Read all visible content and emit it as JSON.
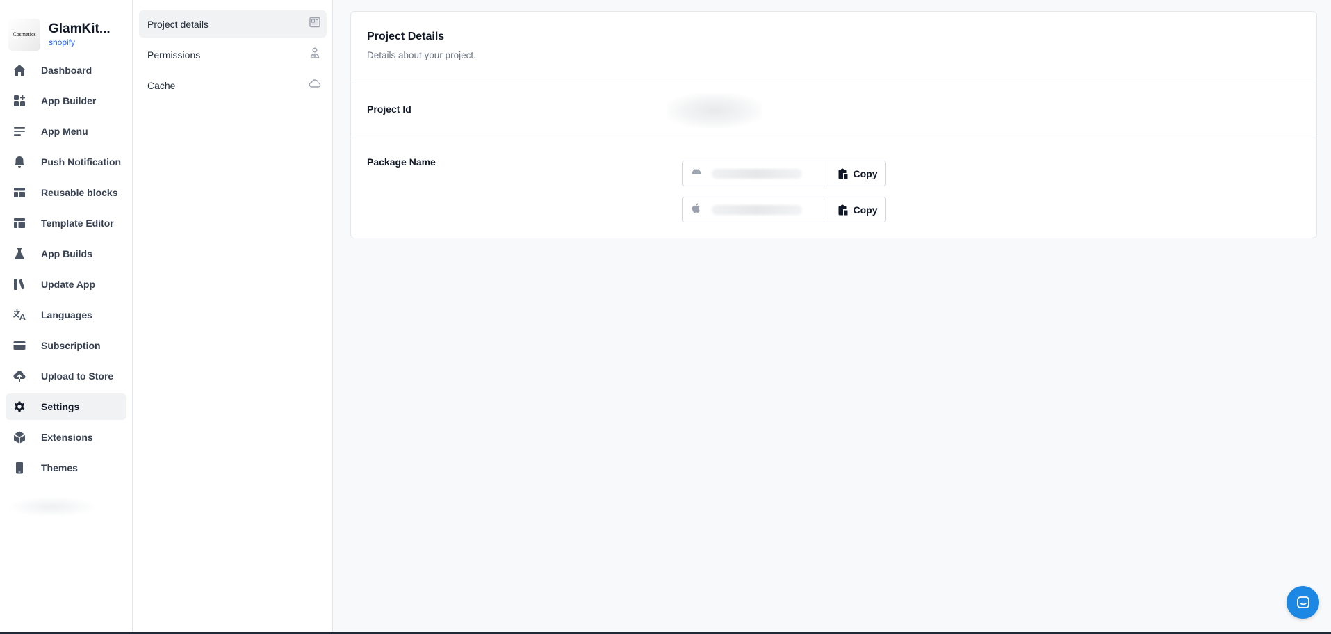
{
  "brand": {
    "name": "GlamKit...",
    "platform": "shopify",
    "logo_text": "Cosmetics"
  },
  "sidebar": {
    "items": [
      {
        "label": "Dashboard",
        "icon": "home-icon"
      },
      {
        "label": "App Builder",
        "icon": "grid-plus-icon"
      },
      {
        "label": "App Menu",
        "icon": "menu-lines-icon"
      },
      {
        "label": "Push Notification",
        "icon": "bell-icon"
      },
      {
        "label": "Reusable blocks",
        "icon": "layout-icon"
      },
      {
        "label": "Template Editor",
        "icon": "template-icon"
      },
      {
        "label": "App Builds",
        "icon": "flask-icon"
      },
      {
        "label": "Update App",
        "icon": "update-icon"
      },
      {
        "label": "Languages",
        "icon": "translate-icon"
      },
      {
        "label": "Subscription",
        "icon": "card-icon"
      },
      {
        "label": "Upload to Store",
        "icon": "cloud-upload-icon"
      },
      {
        "label": "Settings",
        "icon": "gear-icon",
        "active": true
      },
      {
        "label": "Extensions",
        "icon": "cube-icon"
      },
      {
        "label": "Themes",
        "icon": "phone-icon"
      }
    ]
  },
  "submenu": {
    "items": [
      {
        "label": "Project details",
        "icon": "document-icon",
        "active": true
      },
      {
        "label": "Permissions",
        "icon": "users-icon"
      },
      {
        "label": "Cache",
        "icon": "cloud-icon"
      }
    ]
  },
  "card": {
    "title": "Project Details",
    "subtitle": "Details about your project.",
    "project_id_label": "Project Id",
    "package_name_label": "Package Name",
    "android_copy": "Copy",
    "ios_copy": "Copy"
  },
  "colors": {
    "accent": "#2563eb",
    "chat": "#1d87e4",
    "active_bg": "#f1f2f4"
  }
}
